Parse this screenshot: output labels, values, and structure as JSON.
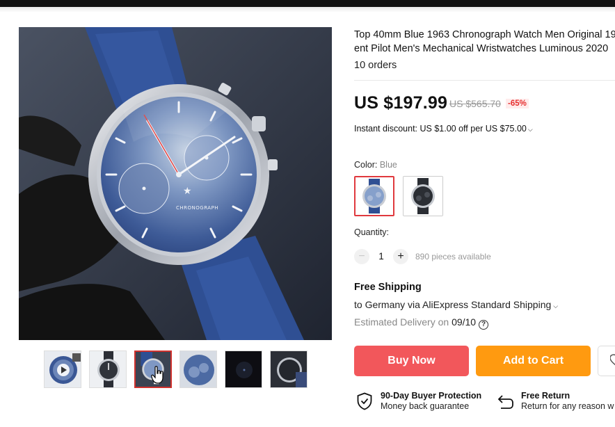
{
  "product": {
    "title_line1": "Top 40mm Blue 1963 Chronograph Watch Men Original 19",
    "title_line2": "ent Pilot Men's Mechanical Wristwatches Luminous 2020",
    "orders": "10 orders"
  },
  "pricing": {
    "price": "US $197.99",
    "original_price": "US $565.70",
    "discount_badge": "-65%",
    "instant_discount": "Instant discount: US $1.00 off per US $75.00"
  },
  "options": {
    "color_label": "Color:",
    "color_value": "Blue",
    "swatches": [
      {
        "name": "Blue",
        "selected": true
      },
      {
        "name": "Black",
        "selected": false
      }
    ]
  },
  "quantity": {
    "label": "Quantity:",
    "value": "1",
    "available": "890 pieces available",
    "minus_icon": "minus-icon",
    "plus_icon": "plus-icon"
  },
  "shipping": {
    "title": "Free Shipping",
    "route": "to Germany via AliExpress Standard Shipping",
    "delivery_label": "Estimated Delivery on",
    "delivery_date": "09/10"
  },
  "actions": {
    "buy_now": "Buy Now",
    "add_to_cart": "Add to Cart"
  },
  "guarantees": [
    {
      "title": "90-Day Buyer Protection",
      "subtitle": "Money back guarantee",
      "icon": "shield-check-icon"
    },
    {
      "title": "Free Return",
      "subtitle": "Return for any reason w",
      "icon": "return-icon"
    }
  ],
  "gallery": {
    "thumbnails": [
      "video",
      "black-watch",
      "blue-watch",
      "blue-dial-closeup",
      "dark-lume",
      "black-dial-angle"
    ],
    "active_index": 2
  },
  "colors": {
    "accent_red": "#f2575b",
    "cart_orange": "#ff9a10",
    "discount_red": "#e62e2e",
    "dial_blue": "#5b7bb0",
    "strap_blue": "#2f4f93"
  }
}
